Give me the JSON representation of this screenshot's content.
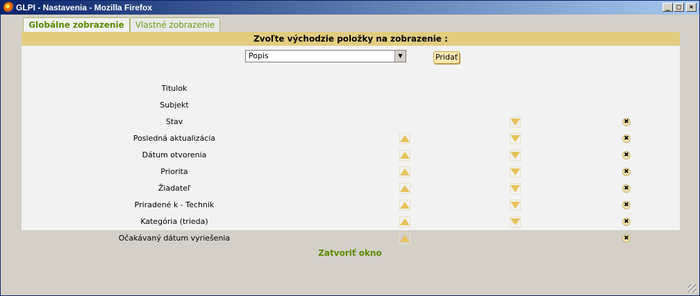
{
  "window": {
    "title": "GLPI - Nastavenia - Mozilla Firefox",
    "controls": {
      "minimize": "_",
      "maximize": "□",
      "close": "×"
    }
  },
  "tabs": [
    {
      "label": "Globálne zobrazenie",
      "active": true
    },
    {
      "label": "Vlastné zobrazenie",
      "active": false
    }
  ],
  "panel": {
    "header": "Zvoľte východzie položky na zobrazenie :",
    "select_value": "Popis",
    "select_arrow": "▼",
    "add_label": "Pridať",
    "rows": [
      {
        "label": "Titulok",
        "up": false,
        "down": false,
        "del": false
      },
      {
        "label": "Subjekt",
        "up": false,
        "down": false,
        "del": false
      },
      {
        "label": "Stav",
        "up": false,
        "down": true,
        "del": true
      },
      {
        "label": "Posledná aktualizácia",
        "up": true,
        "down": true,
        "del": true
      },
      {
        "label": "Dátum otvorenia",
        "up": true,
        "down": true,
        "del": true
      },
      {
        "label": "Priorita",
        "up": true,
        "down": true,
        "del": true
      },
      {
        "label": "Žiadateľ",
        "up": true,
        "down": true,
        "del": true
      },
      {
        "label": "Priradené k - Technik",
        "up": true,
        "down": true,
        "del": true
      },
      {
        "label": "Kategória (trieda)",
        "up": true,
        "down": true,
        "del": true
      },
      {
        "label": "Očakávaný dátum vyriešenia",
        "up": true,
        "down": false,
        "del": true
      }
    ],
    "del_glyph": "✖"
  },
  "close_link": "Zatvoriť okno",
  "colors": {
    "header_bg": "#e2cd7f",
    "panel_bg": "#f2f2f2",
    "accent": "#5a8a00",
    "titlebar": "#0a246a"
  }
}
